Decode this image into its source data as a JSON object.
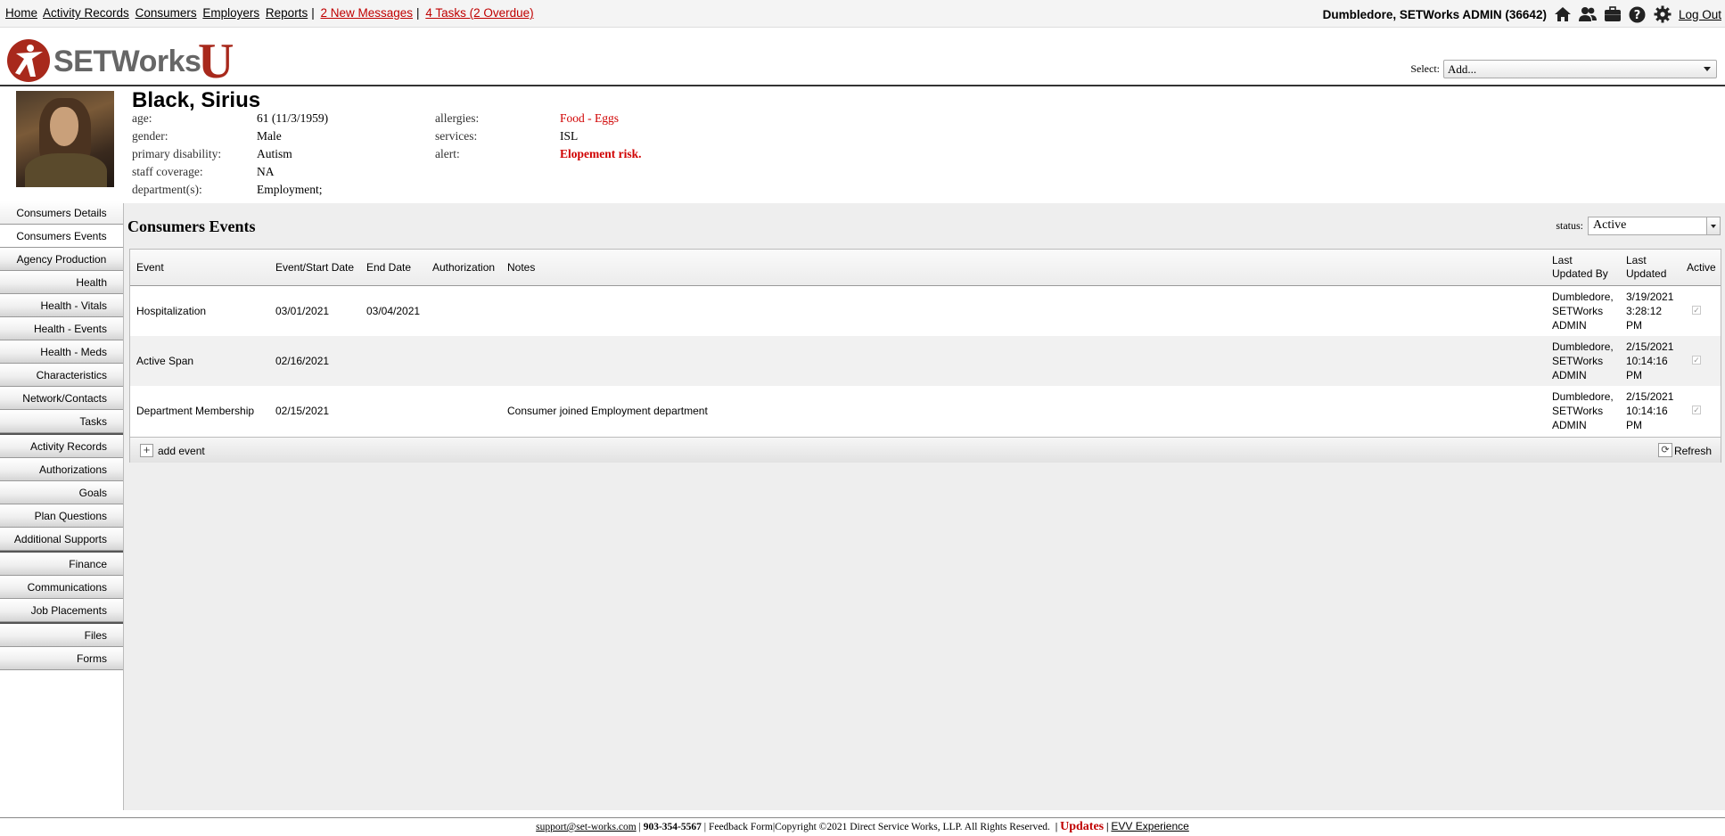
{
  "nav": {
    "links": [
      "Home",
      "Activity Records",
      "Consumers",
      "Employers",
      "Reports"
    ],
    "messages": "2 New Messages",
    "tasks": "4 Tasks (2 Overdue)",
    "user": "Dumbledore, SETWorks ADMIN  (36642)",
    "logout": "Log Out",
    "icons": [
      "home-icon",
      "users-icon",
      "briefcase-icon",
      "help-icon",
      "gear-icon"
    ]
  },
  "logo": {
    "text": "SETWorks",
    "letter": "U"
  },
  "select": {
    "label": "Select:",
    "value": "Add..."
  },
  "consumer": {
    "name": "Black, Sirius",
    "fields": [
      {
        "label": "age:",
        "value": "61 (11/3/1959)"
      },
      {
        "label": "gender:",
        "value": "Male"
      },
      {
        "label": "primary disability:",
        "value": "Autism"
      },
      {
        "label": "staff coverage:",
        "value": "NA"
      },
      {
        "label": "department(s):",
        "value": "Employment;"
      }
    ],
    "fields2": [
      {
        "label": "allergies:",
        "value": "Food - Eggs"
      },
      {
        "label": "services:",
        "value": "ISL"
      },
      {
        "label": "alert:",
        "value": "Elopement risk."
      }
    ]
  },
  "sidebar": {
    "items": [
      "Consumers Details",
      "Consumers Events",
      "Agency Production",
      "Health",
      "Health - Vitals",
      "Health - Events",
      "Health - Meds",
      "Characteristics",
      "Network/Contacts",
      "Tasks",
      "Activity Records",
      "Authorizations",
      "Goals",
      "Plan Questions",
      "Additional Supports",
      "Finance",
      "Communications",
      "Job Placements",
      "Files",
      "Forms"
    ]
  },
  "main": {
    "title": "Consumers Events",
    "status_label": "status:",
    "status_value": "Active",
    "columns": [
      "Event",
      "Event/Start Date",
      "End Date",
      "Authorization",
      "Notes",
      "Last\nUpdated By",
      "Last\nUpdated",
      "Active"
    ],
    "rows": [
      {
        "event": "Hospitalization",
        "start": "03/01/2021",
        "end": "03/04/2021",
        "auth": "",
        "notes": "",
        "by": [
          "Dumbledore,",
          "SETWorks",
          "ADMIN"
        ],
        "updated": [
          "3/19/2021",
          "3:28:12",
          "PM"
        ],
        "active": true
      },
      {
        "event": "Active Span",
        "start": "02/16/2021",
        "end": "",
        "auth": "",
        "notes": "",
        "by": [
          "Dumbledore,",
          "SETWorks",
          "ADMIN"
        ],
        "updated": [
          "2/15/2021",
          "10:14:16",
          "PM"
        ],
        "active": true
      },
      {
        "event": "Department Membership",
        "start": "02/15/2021",
        "end": "",
        "auth": "",
        "notes": "Consumer joined Employment department",
        "by": [
          "Dumbledore,",
          "SETWorks",
          "ADMIN"
        ],
        "updated": [
          "2/15/2021",
          "10:14:16",
          "PM"
        ],
        "active": true
      }
    ],
    "add_label": "add event",
    "refresh_label": "Refresh"
  },
  "footer": {
    "email": "support@set-works.com",
    "phone": "903-354-5567",
    "feedback": "Feedback Form",
    "copyright": "Copyright ©2021 Direct Service Works, LLP. All Rights Reserved.",
    "updates": "Updates",
    "evv": "EVV Experience"
  },
  "colors": {
    "brand_red": "#a8291c",
    "alert_red": "#d00000",
    "link_red": "#c00000"
  }
}
